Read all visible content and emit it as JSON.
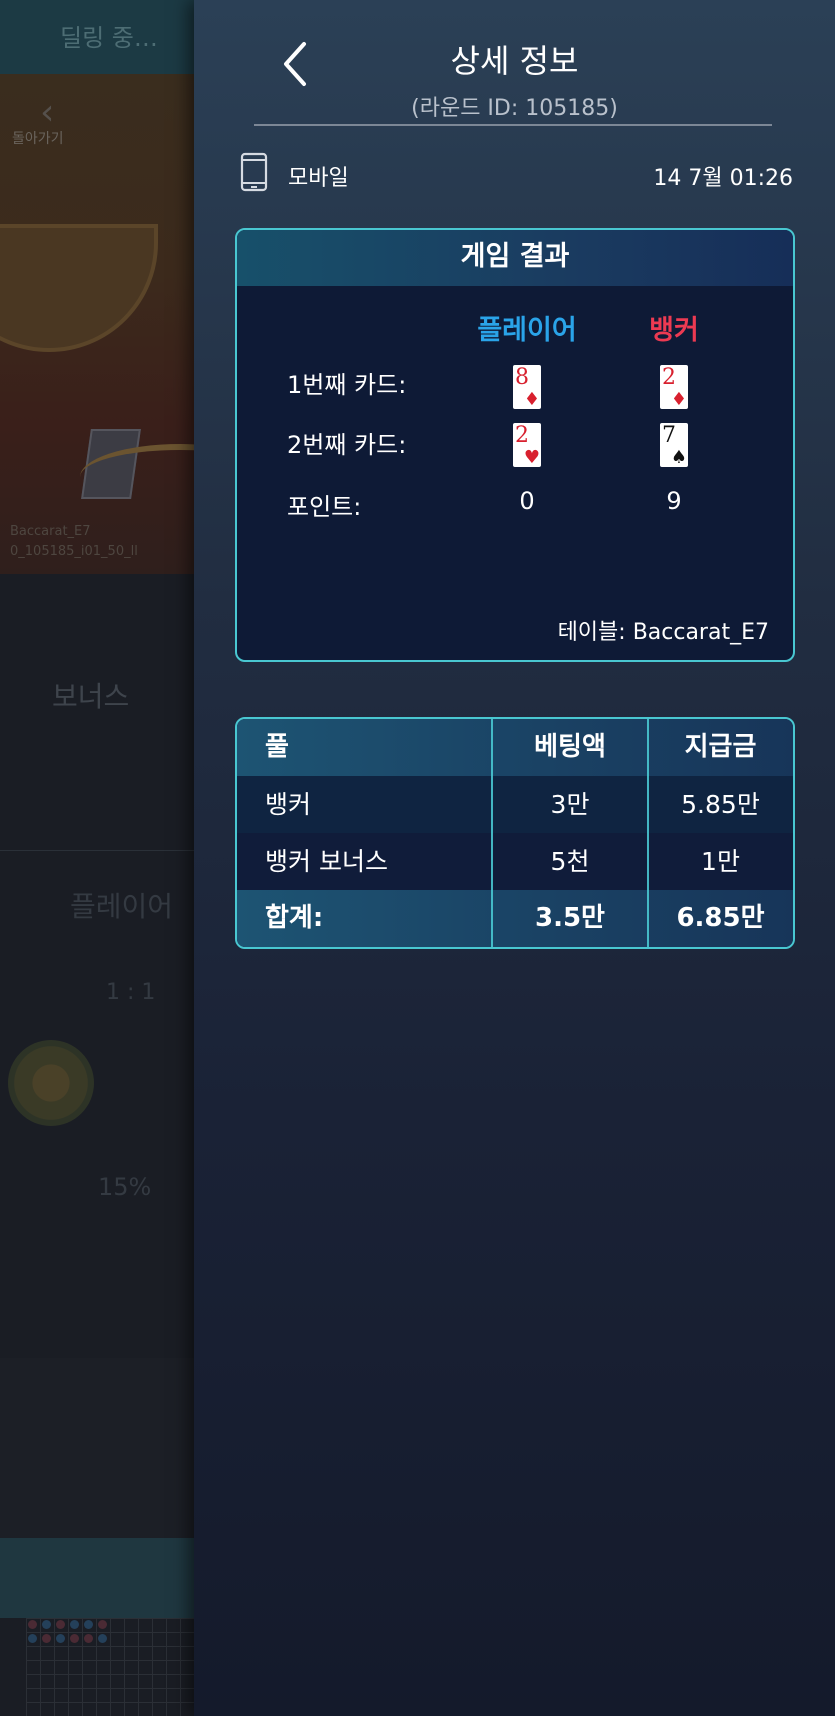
{
  "background": {
    "status": "딜링 중…",
    "back_label": "돌아가기",
    "table_code": "Baccarat_E7",
    "round_code": "0_105185_i01_50_ll",
    "bonus_label": "보너스",
    "player_label": "플레이어",
    "ratio": "1 : 1",
    "percent": "15%"
  },
  "header": {
    "title": "상세 정보",
    "round_id": "(라운드 ID: 105185)"
  },
  "info": {
    "device": "모바일",
    "device_icon": "phone-icon",
    "datetime": "14  7월 01:26"
  },
  "game_result": {
    "title": "게임 결과",
    "player_label": "플레이어",
    "banker_label": "뱅커",
    "card1_label": "1번째  카드:",
    "card2_label": "2번째 카드:",
    "points_label": "포인트:",
    "player_cards": [
      {
        "rank": "8",
        "suit": "♦",
        "color": "red"
      },
      {
        "rank": "2",
        "suit": "♥",
        "color": "red"
      }
    ],
    "banker_cards": [
      {
        "rank": "2",
        "suit": "♦",
        "color": "red"
      },
      {
        "rank": "7",
        "suit": "♠",
        "color": "black"
      }
    ],
    "player_points": "0",
    "banker_points": "9",
    "table": "테이블: Baccarat_E7"
  },
  "bets": {
    "headers": [
      "풀",
      "베팅액",
      "지급금"
    ],
    "rows": [
      [
        "뱅커",
        "3만",
        "5.85만"
      ],
      [
        "뱅커 보너스",
        "5천",
        "1만"
      ]
    ],
    "total": [
      "합계:",
      "3.5만",
      "6.85만"
    ]
  },
  "colors": {
    "accent_border": "#49c7d1",
    "player": "#2aa4e9",
    "banker": "#ec3a52"
  }
}
